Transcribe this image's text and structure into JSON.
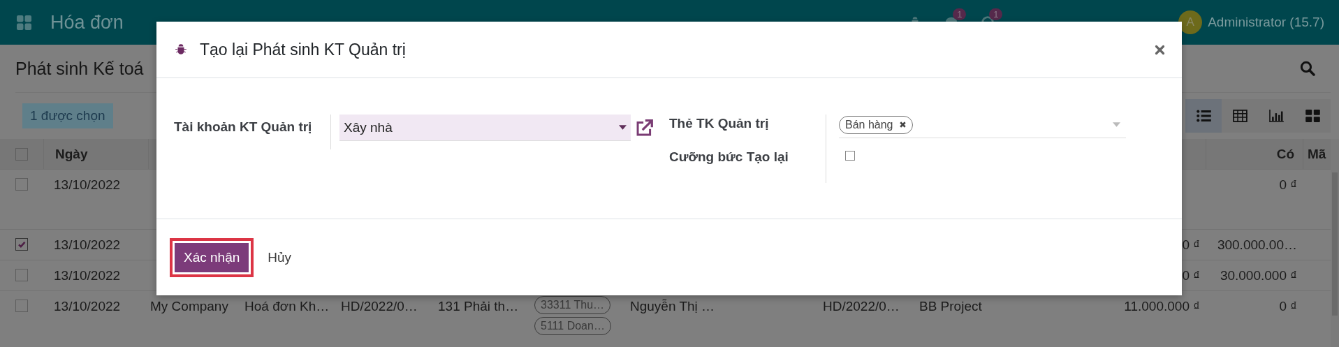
{
  "navbar": {
    "app_name": "Hóa đơn",
    "chat_count": "1",
    "activity_count": "1",
    "avatar_letter": "A",
    "user": "Administrator (15.7)"
  },
  "page": {
    "title": "Phát sinh Kế toá",
    "selection": "1 được chọn",
    "views": [
      {
        "kind": "list",
        "selected": true
      },
      {
        "kind": "pivot",
        "selected": false
      },
      {
        "kind": "graph",
        "selected": false
      },
      {
        "kind": "kanban",
        "selected": false
      }
    ]
  },
  "table": {
    "header_checked": false,
    "headers": {
      "date": "Ngày",
      "credit": "Có",
      "code": "Mã"
    },
    "rows": [
      {
        "selected": false,
        "date": "13/10/2022",
        "credit": "0 ₫"
      },
      {
        "selected": true,
        "date": "13/10/2022",
        "debit": "0 ₫",
        "credit": "300.000.00…"
      },
      {
        "selected": false,
        "date": "13/10/2022",
        "debit": "0 ₫",
        "credit": "30.000.000 ₫"
      },
      {
        "selected": false,
        "date": "13/10/2022",
        "company": "My Company",
        "journal": "Hoá đơn Kh…",
        "entry": "HD/2022/0…",
        "account": "131 Phải th…",
        "tags": [
          "33311 Thu…",
          "5111 Doan…"
        ],
        "partner": "Nguyễn Thị …",
        "reference": "HD/2022/0…",
        "project": "BB Project",
        "debit": "11.000.000 ₫",
        "credit": "0 ₫"
      }
    ]
  },
  "dialog": {
    "title": "Tạo lại Phát sinh KT Quản trị",
    "account_label": "Tài khoản KT Quản trị",
    "account_value": "Xây nhà",
    "tags_label": "Thẻ TK Quản trị",
    "tags": [
      "Bán hàng"
    ],
    "force_label": "Cưỡng bức Tạo lại",
    "force_checked": false,
    "buttons": [
      {
        "label": "Xác nhận",
        "kind": "primary",
        "highlighted": true
      },
      {
        "label": "Hủy",
        "kind": "link",
        "highlighted": false
      }
    ]
  }
}
